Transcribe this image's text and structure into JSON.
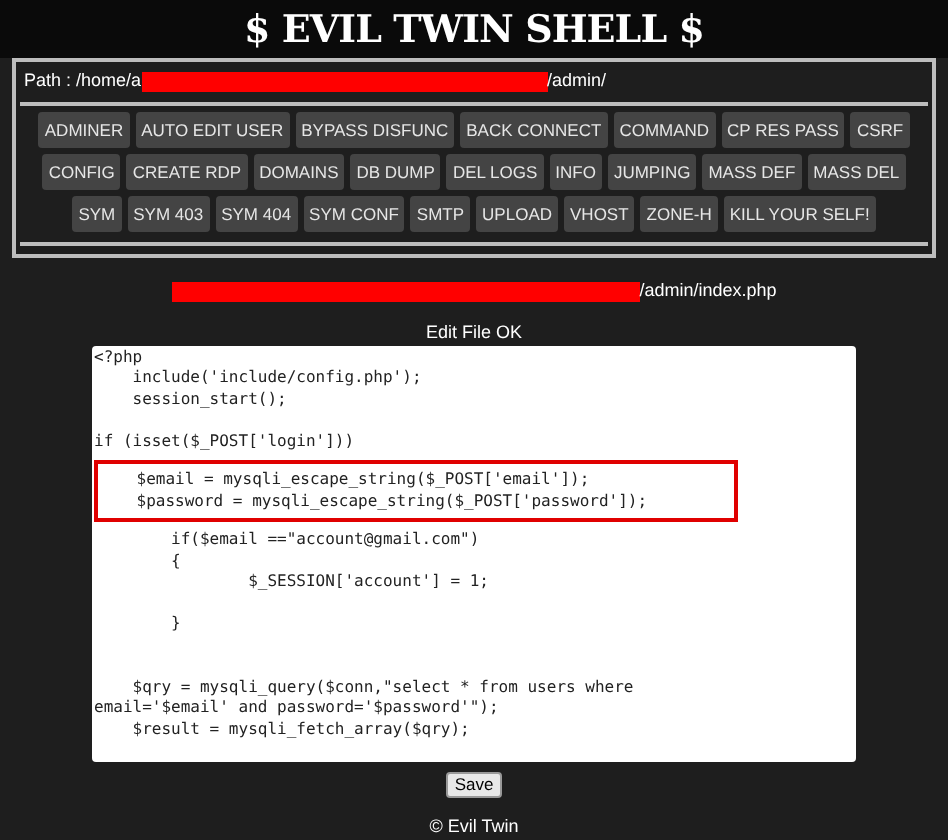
{
  "title": "$ EVIL TWIN SHELL $",
  "path": {
    "prefix": "Path : /home/a",
    "suffix": "/admin/"
  },
  "tools": [
    {
      "label": "ADMINER"
    },
    {
      "label": "AUTO EDIT USER"
    },
    {
      "label": "BYPASS DISFUNC"
    },
    {
      "label": "BACK CONNECT"
    },
    {
      "label": "COMMAND"
    },
    {
      "label": "CP RES PASS"
    },
    {
      "label": "CSRF"
    },
    {
      "label": "CONFIG"
    },
    {
      "label": "CREATE RDP"
    },
    {
      "label": "DOMAINS"
    },
    {
      "label": "DB DUMP"
    },
    {
      "label": "DEL LOGS"
    },
    {
      "label": "INFO"
    },
    {
      "label": "JUMPING"
    },
    {
      "label": "MASS DEF"
    },
    {
      "label": "MASS DEL"
    },
    {
      "label": "SYM"
    },
    {
      "label": "SYM 403"
    },
    {
      "label": "SYM 404"
    },
    {
      "label": "SYM CONF"
    },
    {
      "label": "SMTP"
    },
    {
      "label": "UPLOAD"
    },
    {
      "label": "VHOST"
    },
    {
      "label": "ZONE-H"
    },
    {
      "label": "KILL YOUR SELF!"
    }
  ],
  "file_path": {
    "suffix": "/admin/index.php"
  },
  "status": "Edit File OK",
  "code_blocks": [
    {
      "highlighted": false,
      "text": "<?php\n    include('include/config.php');\n    session_start();\n\nif (isset($_POST['login']))"
    },
    {
      "highlighted": true,
      "text": "    $email = mysqli_escape_string($_POST['email']);\n    $password = mysqli_escape_string($_POST['password']);"
    },
    {
      "highlighted": false,
      "text": "        if($email ==\"account@gmail.com\")\n        {\n                $_SESSION['account'] = 1;\n\n        }\n\n\n    $qry = mysqli_query($conn,\"select * from users where\nemail='$email' and password='$password'\");\n    $result = mysqli_fetch_array($qry);"
    }
  ],
  "save_button": "Save",
  "footer": "© Evil Twin"
}
